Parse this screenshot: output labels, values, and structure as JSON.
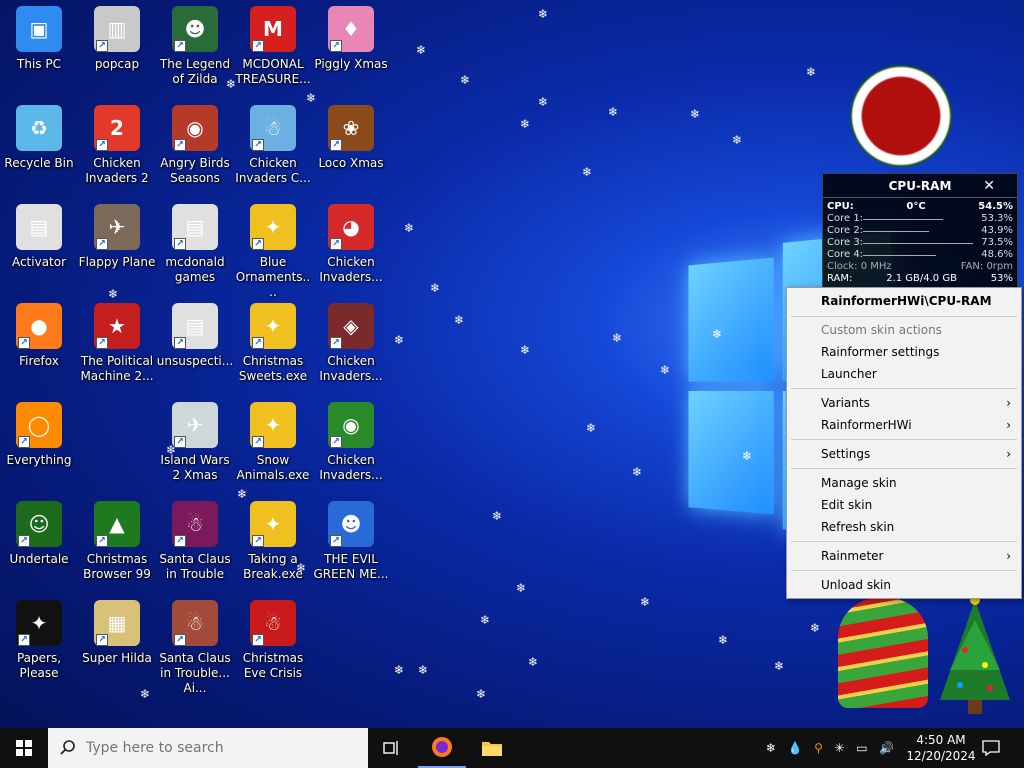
{
  "desktop": {
    "icons": [
      {
        "label": "This PC",
        "color": "#2e8bf0",
        "glyph": "▣"
      },
      {
        "label": "Recycle Bin",
        "color": "#5bb8e8",
        "glyph": "♻"
      },
      {
        "label": "Activator",
        "color": "#e0e0e0",
        "glyph": "▤"
      },
      {
        "label": "Firefox",
        "color": "#ff7a1a",
        "glyph": "●"
      },
      {
        "label": "Everything",
        "color": "#ff8c00",
        "glyph": "◯"
      },
      {
        "label": "Undertale",
        "color": "#1c6b1c",
        "glyph": "☺"
      },
      {
        "label": "Papers, Please",
        "color": "#111111",
        "glyph": "✦"
      },
      {
        "label": "popcap",
        "color": "#c9c9c9",
        "glyph": "▥"
      },
      {
        "label": "Chicken Invaders 2",
        "color": "#e23a2a",
        "glyph": "2"
      },
      {
        "label": "Flappy Plane",
        "color": "#7b6a5a",
        "glyph": "✈"
      },
      {
        "label": "The Political Machine 2...",
        "color": "#c41e1e",
        "glyph": "★"
      },
      {
        "label": "",
        "color": "",
        "glyph": ""
      },
      {
        "label": "Christmas Browser 99",
        "color": "#1e7a1e",
        "glyph": "▲"
      },
      {
        "label": "Super Hilda",
        "color": "#d8c27a",
        "glyph": "▦"
      },
      {
        "label": "The Legend of Zilda",
        "color": "#2a6b3a",
        "glyph": "☻"
      },
      {
        "label": "Angry Birds Seasons",
        "color": "#b53a2a",
        "glyph": "◉"
      },
      {
        "label": "mcdonald games",
        "color": "#e0e0e0",
        "glyph": "▤"
      },
      {
        "label": "unsuspecti...",
        "color": "#e0e0e0",
        "glyph": "▤"
      },
      {
        "label": "Island Wars 2 Xmas",
        "color": "#cfd8d8",
        "glyph": "✈"
      },
      {
        "label": "Santa Claus in Trouble",
        "color": "#7a1a5a",
        "glyph": "☃"
      },
      {
        "label": "Santa Claus in Trouble... Ai...",
        "color": "#a34a3a",
        "glyph": "☃"
      },
      {
        "label": "MCDONAL TREASURE...",
        "color": "#d61f1f",
        "glyph": "M"
      },
      {
        "label": "Chicken Invaders C...",
        "color": "#6bb0e0",
        "glyph": "☃"
      },
      {
        "label": "Blue Ornaments....",
        "color": "#f0c020",
        "glyph": "✦"
      },
      {
        "label": "Christmas Sweets.exe",
        "color": "#f0c020",
        "glyph": "✦"
      },
      {
        "label": "Snow Animals.exe",
        "color": "#f0c020",
        "glyph": "✦"
      },
      {
        "label": "Taking a Break.exe",
        "color": "#f0c020",
        "glyph": "✦"
      },
      {
        "label": "Christmas Eve Crisis",
        "color": "#c81a1a",
        "glyph": "☃"
      },
      {
        "label": "Piggly Xmas",
        "color": "#e887b6",
        "glyph": "♦"
      },
      {
        "label": "Loco Xmas",
        "color": "#8b4a1a",
        "glyph": "❀"
      },
      {
        "label": "Chicken Invaders...",
        "color": "#d62a2a",
        "glyph": "◕"
      },
      {
        "label": "Chicken Invaders...",
        "color": "#7a2a2a",
        "glyph": "◈"
      },
      {
        "label": "Chicken Invaders...",
        "color": "#2a8a2a",
        "glyph": "◉"
      },
      {
        "label": "THE EVIL GREEN ME...",
        "color": "#2a6ad6",
        "glyph": "☻"
      }
    ]
  },
  "widget": {
    "title": "CPU-RAM",
    "cpu_label": "CPU:",
    "cpu_temp": "0°C",
    "cpu_val": "54.5%",
    "core1_label": "Core 1:",
    "core1_val": "53.3%",
    "core2_label": "Core 2:",
    "core2_val": "43.9%",
    "core3_label": "Core 3:",
    "core3_val": "73.5%",
    "core4_label": "Core 4:",
    "core4_val": "48.6%",
    "clock_label": "Clock: 0 MHz",
    "fan_label": "FAN: 0rpm",
    "ram_label": "RAM:",
    "ram_val": "2.1 GB/4.0 GB",
    "ram_pct": "53%"
  },
  "context_menu": {
    "header": "RainformerHWi\\CPU-RAM",
    "custom_actions": "Custom skin actions",
    "rainformer_settings": "Rainformer settings",
    "launcher": "Launcher",
    "variants": "Variants",
    "rainformerhwi": "RainformerHWi",
    "settings": "Settings",
    "manage_skin": "Manage skin",
    "edit_skin": "Edit skin",
    "refresh_skin": "Refresh skin",
    "rainmeter": "Rainmeter",
    "unload_skin": "Unload skin"
  },
  "taskbar": {
    "search_placeholder": "Type here to search",
    "time": "4:50 AM",
    "date": "12/20/2024"
  }
}
